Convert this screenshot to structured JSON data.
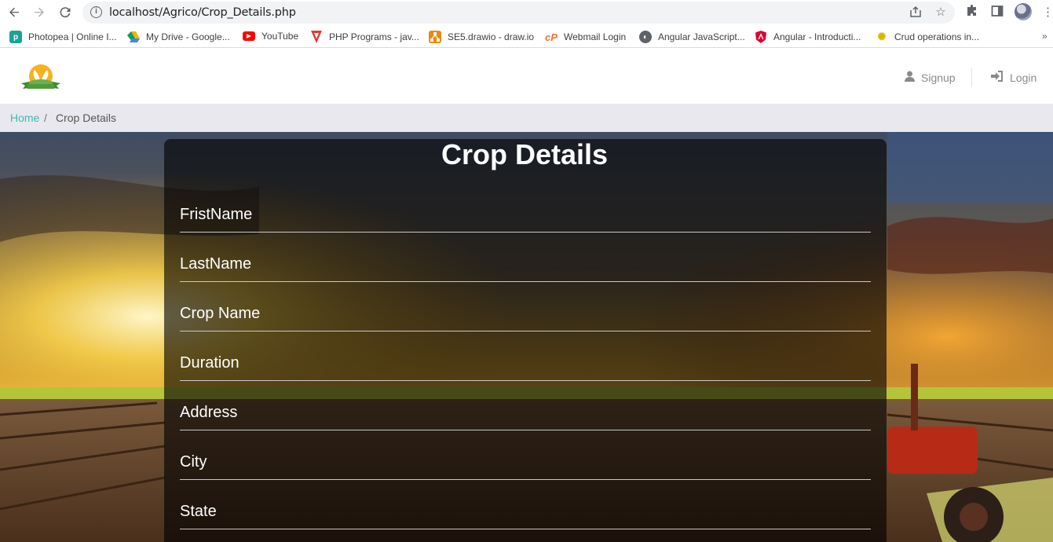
{
  "browser": {
    "url": "localhost/Agrico/Crop_Details.php",
    "bookmarks": [
      {
        "label": "Photopea | Online I...",
        "icon": "photopea-icon",
        "color": "#18a497"
      },
      {
        "label": "My Drive - Google...",
        "icon": "google-drive-icon",
        "color": "#f4b400"
      },
      {
        "label": "YouTube",
        "icon": "youtube-icon",
        "color": "#ff0000"
      },
      {
        "label": "PHP Programs - jav...",
        "icon": "tpoint-icon",
        "color": "#e53935"
      },
      {
        "label": "SE5.drawio - draw.io",
        "icon": "drawio-icon",
        "color": "#f08705"
      },
      {
        "label": "Webmail Login",
        "icon": "cpanel-icon",
        "color": "#ff6c2c"
      },
      {
        "label": "Angular JavaScript...",
        "icon": "globe-icon",
        "color": "#5f6368"
      },
      {
        "label": "Angular - Introducti...",
        "icon": "angular-icon",
        "color": "#dd0031"
      },
      {
        "label": "Crud operations in...",
        "icon": "bulb-icon",
        "color": "#9aa0a6"
      }
    ],
    "more": "»"
  },
  "header": {
    "signup_label": "Signup",
    "login_label": "Login"
  },
  "breadcrumb": {
    "home": "Home",
    "separator": "/",
    "current": "Crop Details"
  },
  "form": {
    "title": "Crop Details",
    "fields": [
      {
        "placeholder": "FristName"
      },
      {
        "placeholder": "LastName"
      },
      {
        "placeholder": "Crop Name"
      },
      {
        "placeholder": "Duration"
      },
      {
        "placeholder": "Address"
      },
      {
        "placeholder": "City"
      },
      {
        "placeholder": "State"
      }
    ]
  },
  "colors": {
    "accent": "#3fbab3",
    "panel": "#000000"
  }
}
